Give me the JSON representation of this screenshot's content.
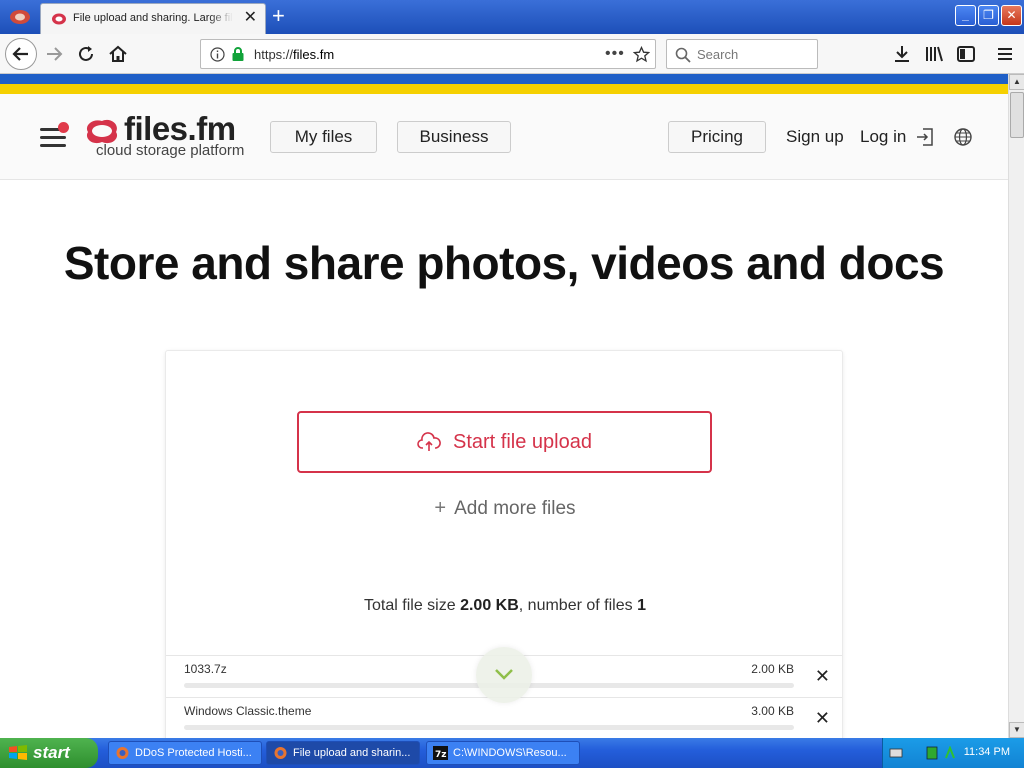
{
  "browser": {
    "tab_title": "File upload and sharing. Large file t",
    "url_prefix": "https://",
    "url_host": "files.fm",
    "search_placeholder": "Search"
  },
  "site": {
    "logo_name": "files.fm",
    "logo_tagline": "cloud storage platform",
    "nav": {
      "my_files": "My files",
      "business": "Business",
      "pricing": "Pricing",
      "sign_up": "Sign up",
      "log_in": "Log in"
    },
    "hero_title": "Store and share photos, videos and docs"
  },
  "upload": {
    "start_label": "Start file upload",
    "add_more_label": "Add more files",
    "totals_prefix": "Total file size ",
    "total_size": "2.00 KB",
    "totals_middle": ", number of files ",
    "file_count": "1",
    "files": [
      {
        "name": "1033.7z",
        "size": "2.00 KB"
      },
      {
        "name": "Windows Classic.theme",
        "size": "3.00 KB"
      }
    ]
  },
  "taskbar": {
    "start_label": "start",
    "tasks": [
      {
        "label": "DDoS Protected Hosti..."
      },
      {
        "label": "File upload and sharin..."
      },
      {
        "label": "C:\\WINDOWS\\Resou..."
      }
    ],
    "clock": "11:34 PM"
  },
  "colors": {
    "brand_red": "#d5334a",
    "ukraine_blue": "#1f5fc7",
    "ukraine_yellow": "#f5d000"
  }
}
